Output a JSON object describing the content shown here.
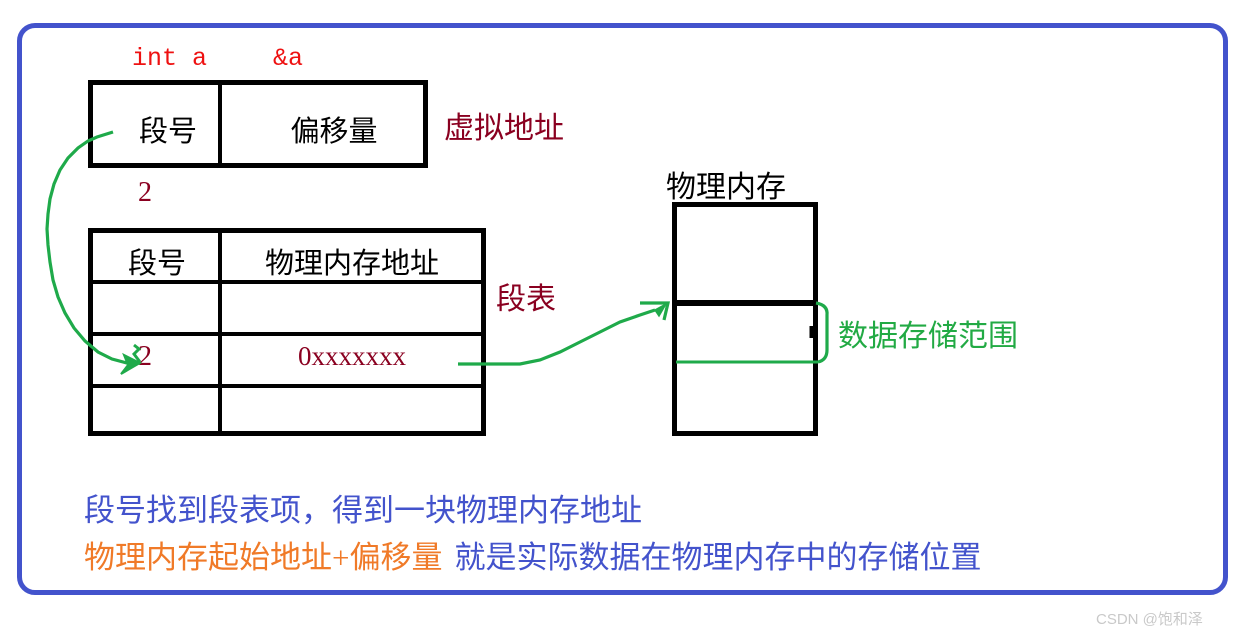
{
  "frame": {
    "accent_color": "#4353cc"
  },
  "virtual_address": {
    "code_var": "int a",
    "code_addr": "&a",
    "seg_cell": "段号",
    "offset_cell": "偏移量",
    "label": "虚拟地址",
    "seg_value": "2"
  },
  "segment_table": {
    "label": "段表",
    "headers": [
      "段号",
      "物理内存地址"
    ],
    "rows": [
      {
        "seg": "",
        "addr": ""
      },
      {
        "seg": "2",
        "addr": "0xxxxxxx"
      },
      {
        "seg": "",
        "addr": ""
      }
    ]
  },
  "physical_memory": {
    "title": "物理内存",
    "range_label": "数据存储范围"
  },
  "notes": {
    "line1": "段号找到段表项，得到一块物理内存地址",
    "line2_part1": "物理内存起始地址+偏移量",
    "line2_part2": "就是实际数据在物理内存中的存储位置"
  },
  "colors": {
    "frame_blue": "#4353cc",
    "code_red": "#ee1111",
    "dark_red": "#8a0020",
    "green": "#22aa44",
    "orange": "#f07a28",
    "black": "#000000"
  },
  "watermark": {
    "text": "CSDN @饱和泽"
  }
}
